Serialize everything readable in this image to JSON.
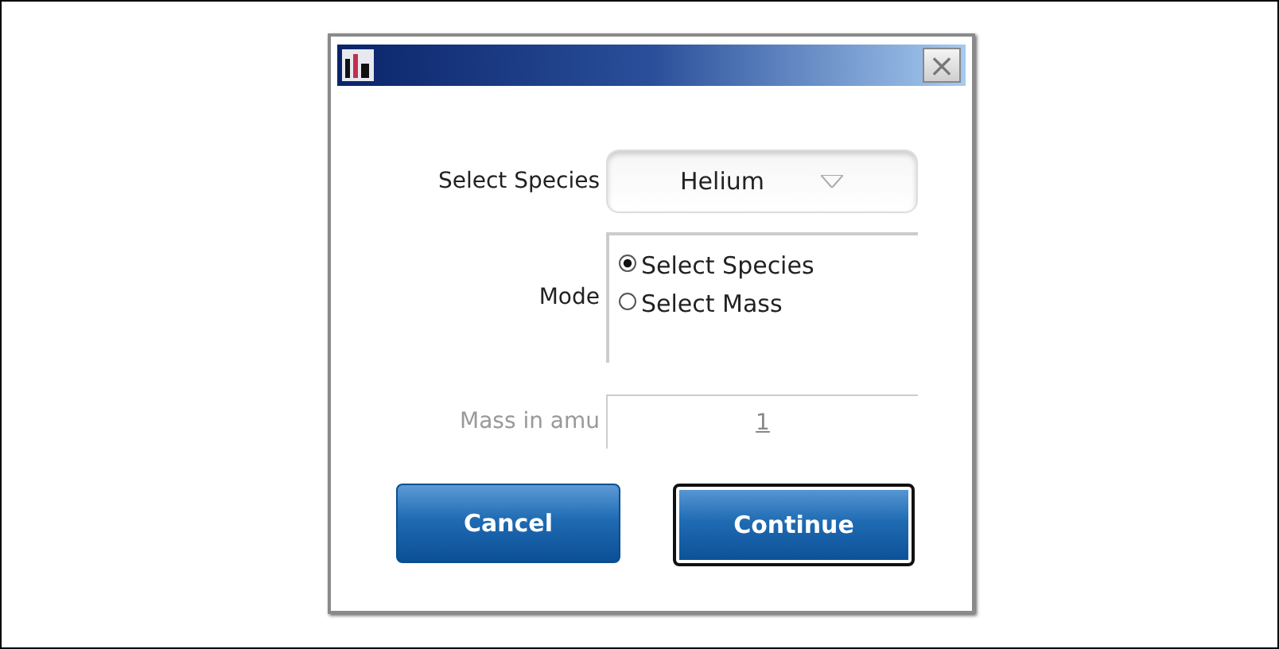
{
  "dialog": {
    "close_symbol": "×"
  },
  "species": {
    "label": "Select Species",
    "value": "Helium"
  },
  "mode": {
    "label": "Mode",
    "options": [
      {
        "label": "Select Species",
        "selected": true
      },
      {
        "label": "Select Mass",
        "selected": false
      }
    ]
  },
  "mass": {
    "label": "Mass in amu",
    "value": "1",
    "disabled": true
  },
  "buttons": [
    {
      "label": "Cancel",
      "focused": false
    },
    {
      "label": "Continue",
      "focused": true
    }
  ]
}
